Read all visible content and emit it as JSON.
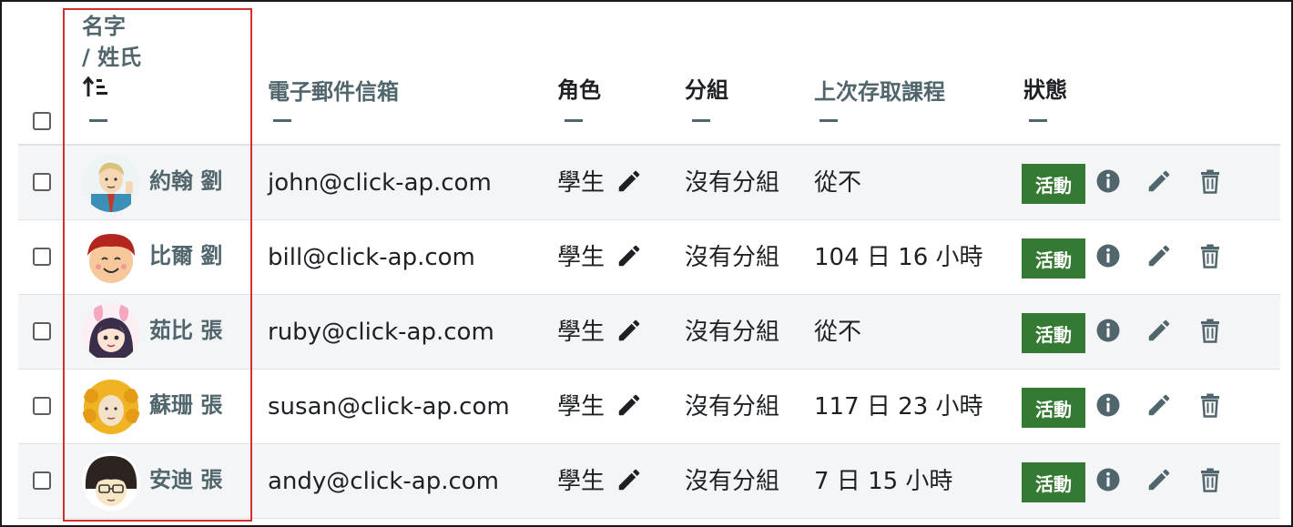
{
  "header": {
    "name_col": {
      "line1": "名字",
      "line2": "/ 姓氏",
      "sort_icon": "sort-ascending-icon"
    },
    "email_col": "電子郵件信箱",
    "role_col": "角色",
    "group_col": "分組",
    "last_access_col": "上次存取課程",
    "status_col": "狀態"
  },
  "colors": {
    "link": "#51666c",
    "badge": "#357a32",
    "row_stripe": "#f4f5f6",
    "highlight": "#d32f2f"
  },
  "rows": [
    {
      "name": "約翰 劉",
      "email": "john@click-ap.com",
      "role": "學生",
      "group": "沒有分組",
      "last_access": "從不",
      "status": "活動",
      "avatar": "businessman-avatar"
    },
    {
      "name": "比爾 劉",
      "email": "bill@click-ap.com",
      "role": "學生",
      "group": "沒有分組",
      "last_access": "104 日 16 小時",
      "status": "活動",
      "avatar": "smiling-boy-avatar"
    },
    {
      "name": "茹比 張",
      "email": "ruby@click-ap.com",
      "role": "學生",
      "group": "沒有分組",
      "last_access": "從不",
      "status": "活動",
      "avatar": "bunny-ears-girl-avatar"
    },
    {
      "name": "蘇珊 張",
      "email": "susan@click-ap.com",
      "role": "學生",
      "group": "沒有分組",
      "last_access": "117 日 23 小時",
      "status": "活動",
      "avatar": "curly-hair-woman-avatar"
    },
    {
      "name": "安迪 張",
      "email": "andy@click-ap.com",
      "role": "學生",
      "group": "沒有分組",
      "last_access": "7 日 15 小時",
      "status": "活動",
      "avatar": "glasses-boy-avatar"
    }
  ]
}
